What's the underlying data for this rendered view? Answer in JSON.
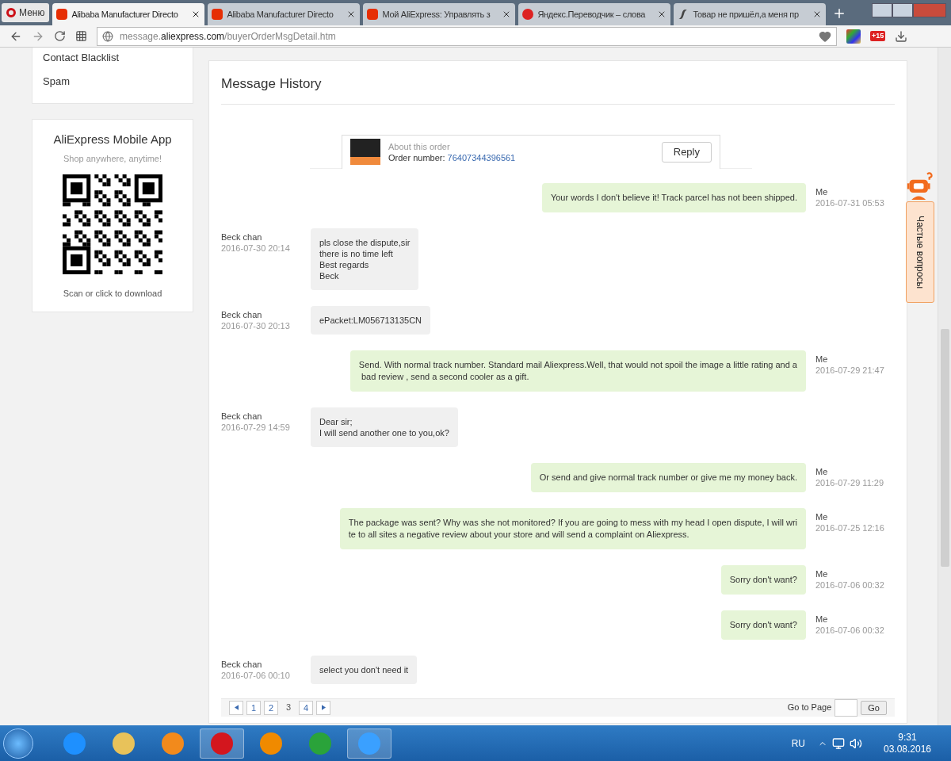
{
  "browser": {
    "menu_label": "Меню",
    "tabs": [
      {
        "title": "Alibaba Manufacturer Directo",
        "kind": "ali",
        "selected": true
      },
      {
        "title": "Alibaba Manufacturer Directo",
        "kind": "ali",
        "selected": false
      },
      {
        "title": "Мой AliExpress: Управлять з",
        "kind": "ali",
        "selected": false
      },
      {
        "title": "Яндекс.Переводчик – слова",
        "kind": "yandex",
        "selected": false
      },
      {
        "title": "Товар не пришёл,а меня пр",
        "kind": "script",
        "selected": false
      }
    ],
    "address": {
      "prefix": "message.",
      "domain": "aliexpress.com",
      "path": "/buyerOrderMsgDetail.htm"
    },
    "extension_badge": "+15"
  },
  "sidebar": {
    "links": [
      "Contact Blacklist",
      "Spam"
    ],
    "app_card": {
      "title": "AliExpress Mobile App",
      "subtitle": "Shop anywhere, anytime!",
      "caption": "Scan or click to download"
    }
  },
  "message_history": {
    "title": "Message History",
    "order": {
      "label": "About this order",
      "number_label": "Order number: ",
      "number": "76407344396561",
      "reply_button": "Reply"
    },
    "messages": [
      {
        "kind": "me",
        "author": "Me",
        "time": "2016-07-31 05:53",
        "text": "Your words I don't believe it! Track parcel has not been shipped."
      },
      {
        "kind": "seller",
        "author": "Beck chan",
        "time": "2016-07-30 20:14",
        "text": "pls close the dispute,sir\nthere is no time left\nBest regards\nBeck"
      },
      {
        "kind": "seller",
        "author": "Beck chan",
        "time": "2016-07-30 20:13",
        "text": "ePacket:LM056713135CN"
      },
      {
        "kind": "me",
        "author": "Me",
        "time": "2016-07-29 21:47",
        "text": "Send. With normal track number. Standard mail Aliexpress.Well, that would not spoil the image a little rating and a\n bad review , send a second cooler as a gift."
      },
      {
        "kind": "seller",
        "author": "Beck chan",
        "time": "2016-07-29 14:59",
        "text": "Dear sir;\nI will send another one to you,ok?"
      },
      {
        "kind": "me",
        "author": "Me",
        "time": "2016-07-29 11:29",
        "text": "Or send and give normal track number or give me my money back."
      },
      {
        "kind": "me",
        "author": "Me",
        "time": "2016-07-25 12:16",
        "text": "The package was sent? Why was she not monitored? If you are going to mess with my head I open dispute, I will wri\nte to all sites a negative review about your store and will send a complaint on Aliexpress."
      },
      {
        "kind": "me",
        "author": "Me",
        "time": "2016-07-06 00:32",
        "text": "Sorry don't want?"
      },
      {
        "kind": "me",
        "author": "Me",
        "time": "2016-07-06 00:32",
        "text": "Sorry don't want?"
      },
      {
        "kind": "seller",
        "author": "Beck chan",
        "time": "2016-07-06 00:10",
        "text": "select you don't need it"
      }
    ],
    "pagination": {
      "pages": [
        {
          "label": "1",
          "selected": false
        },
        {
          "label": "2",
          "selected": false
        },
        {
          "label": "3",
          "selected": true
        },
        {
          "label": "4",
          "selected": false
        }
      ],
      "goto_label": "Go to Page",
      "go_button": "Go"
    }
  },
  "help_widget": {
    "label": "Частые вопросы"
  },
  "taskbar": {
    "language": "RU",
    "time": "9:31",
    "date": "03.08.2016"
  }
}
